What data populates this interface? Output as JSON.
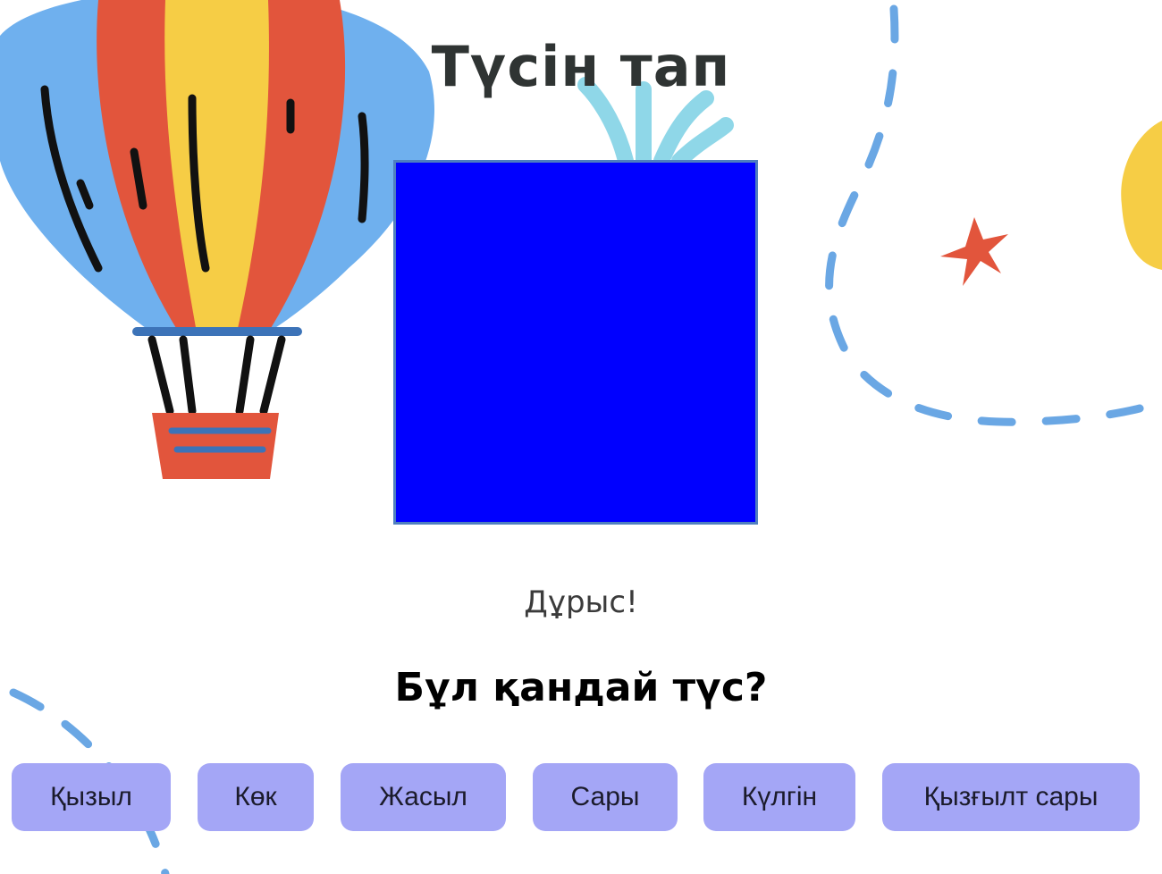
{
  "game": {
    "title": "Түсін тап",
    "current_color": "#0000ff",
    "feedback": "Дұрыс!",
    "question": "Бұл қандай түс?"
  },
  "answers": [
    {
      "label": "Қызыл"
    },
    {
      "label": "Көк"
    },
    {
      "label": "Жасыл"
    },
    {
      "label": "Сары"
    },
    {
      "label": "Күлгін"
    },
    {
      "label": "Қызғылт сары"
    }
  ],
  "colors": {
    "button_bg": "#a4a6f6",
    "balloon_blue": "#6fb0ee",
    "balloon_red": "#e2553c",
    "balloon_yellow": "#f6cd45",
    "dash_blue": "#6aa7e4",
    "star_red": "#e2553c"
  }
}
